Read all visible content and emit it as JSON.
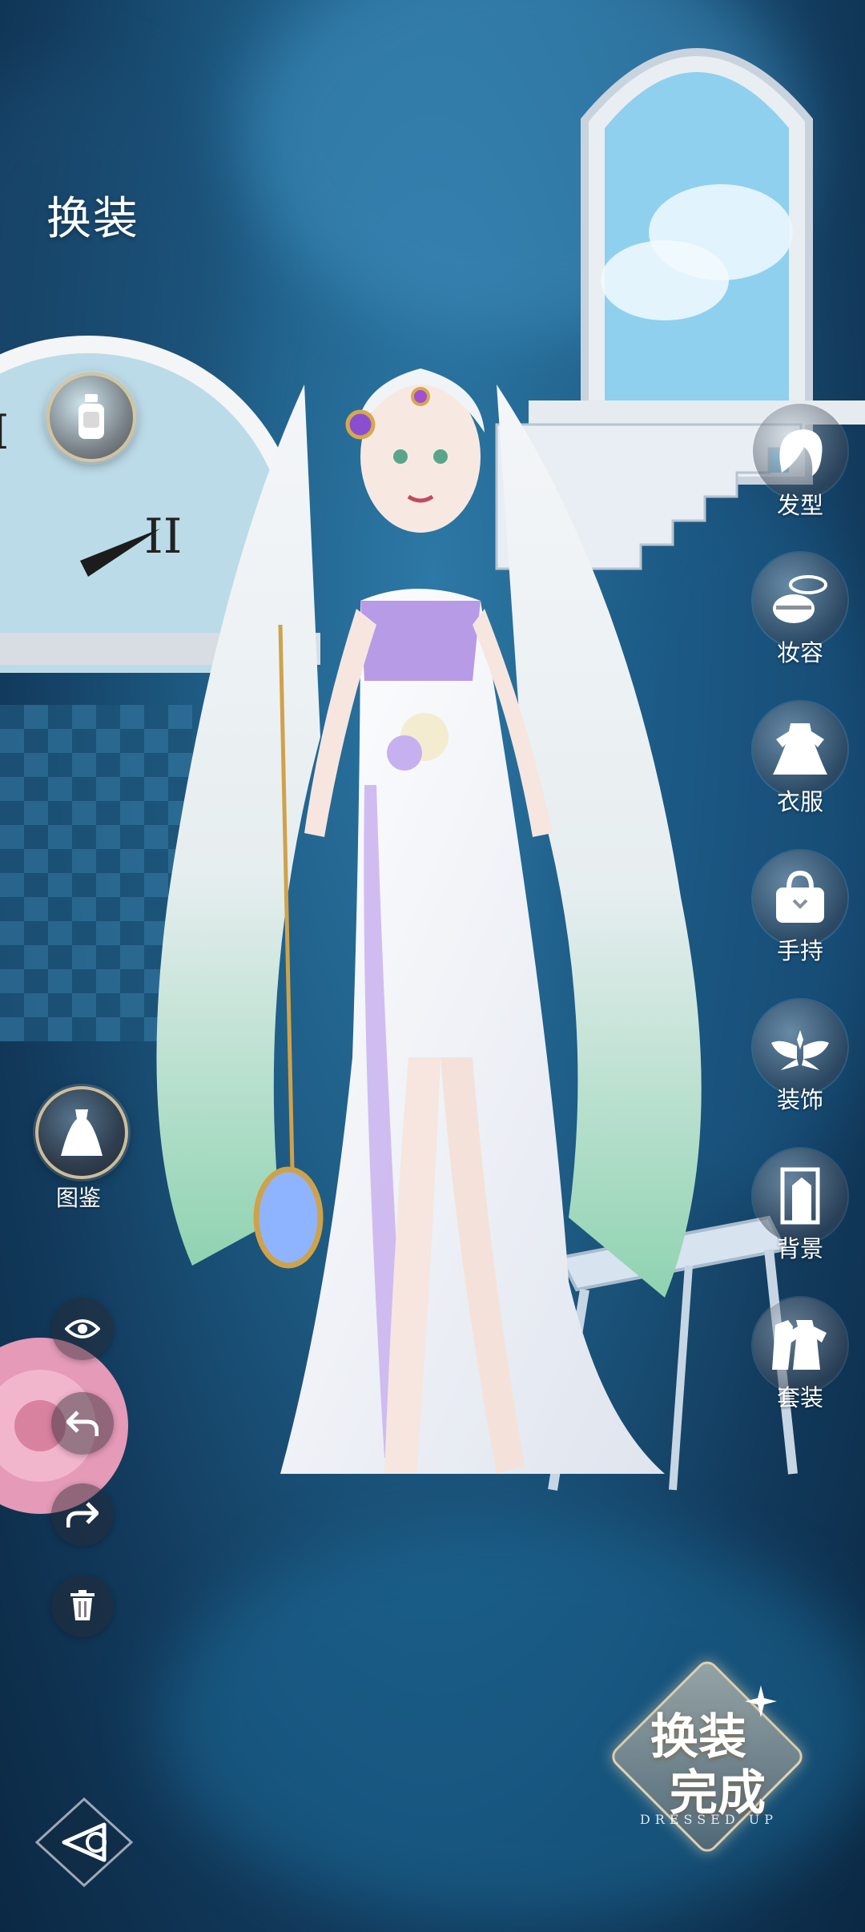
{
  "page": {
    "title": "换装"
  },
  "left_tools": {
    "perfume_button": "perfume-bottle",
    "catalog": {
      "label": "图鉴",
      "icon": "dress-icon"
    },
    "actions": [
      {
        "name": "visibility",
        "icon": "eye-icon"
      },
      {
        "name": "undo",
        "icon": "undo-arrow-icon"
      },
      {
        "name": "redo",
        "icon": "redo-arrow-icon"
      },
      {
        "name": "delete",
        "icon": "trash-icon"
      }
    ]
  },
  "categories": [
    {
      "label": "发型",
      "icon": "hair-icon"
    },
    {
      "label": "妆容",
      "icon": "makeup-icon"
    },
    {
      "label": "衣服",
      "icon": "clothes-icon"
    },
    {
      "label": "手持",
      "icon": "handbag-icon"
    },
    {
      "label": "装饰",
      "icon": "wings-icon"
    },
    {
      "label": "背景",
      "icon": "background-icon"
    },
    {
      "label": "套装",
      "icon": "outfit-set-icon"
    }
  ],
  "done_badge": {
    "line1": "换装",
    "line2": "完成",
    "subtitle": "DRESSED UP"
  },
  "colors": {
    "accent": "#decba0",
    "sky": "#2d78a6",
    "hair_tip": "#8fd3b0",
    "dress": "#b89be6"
  }
}
